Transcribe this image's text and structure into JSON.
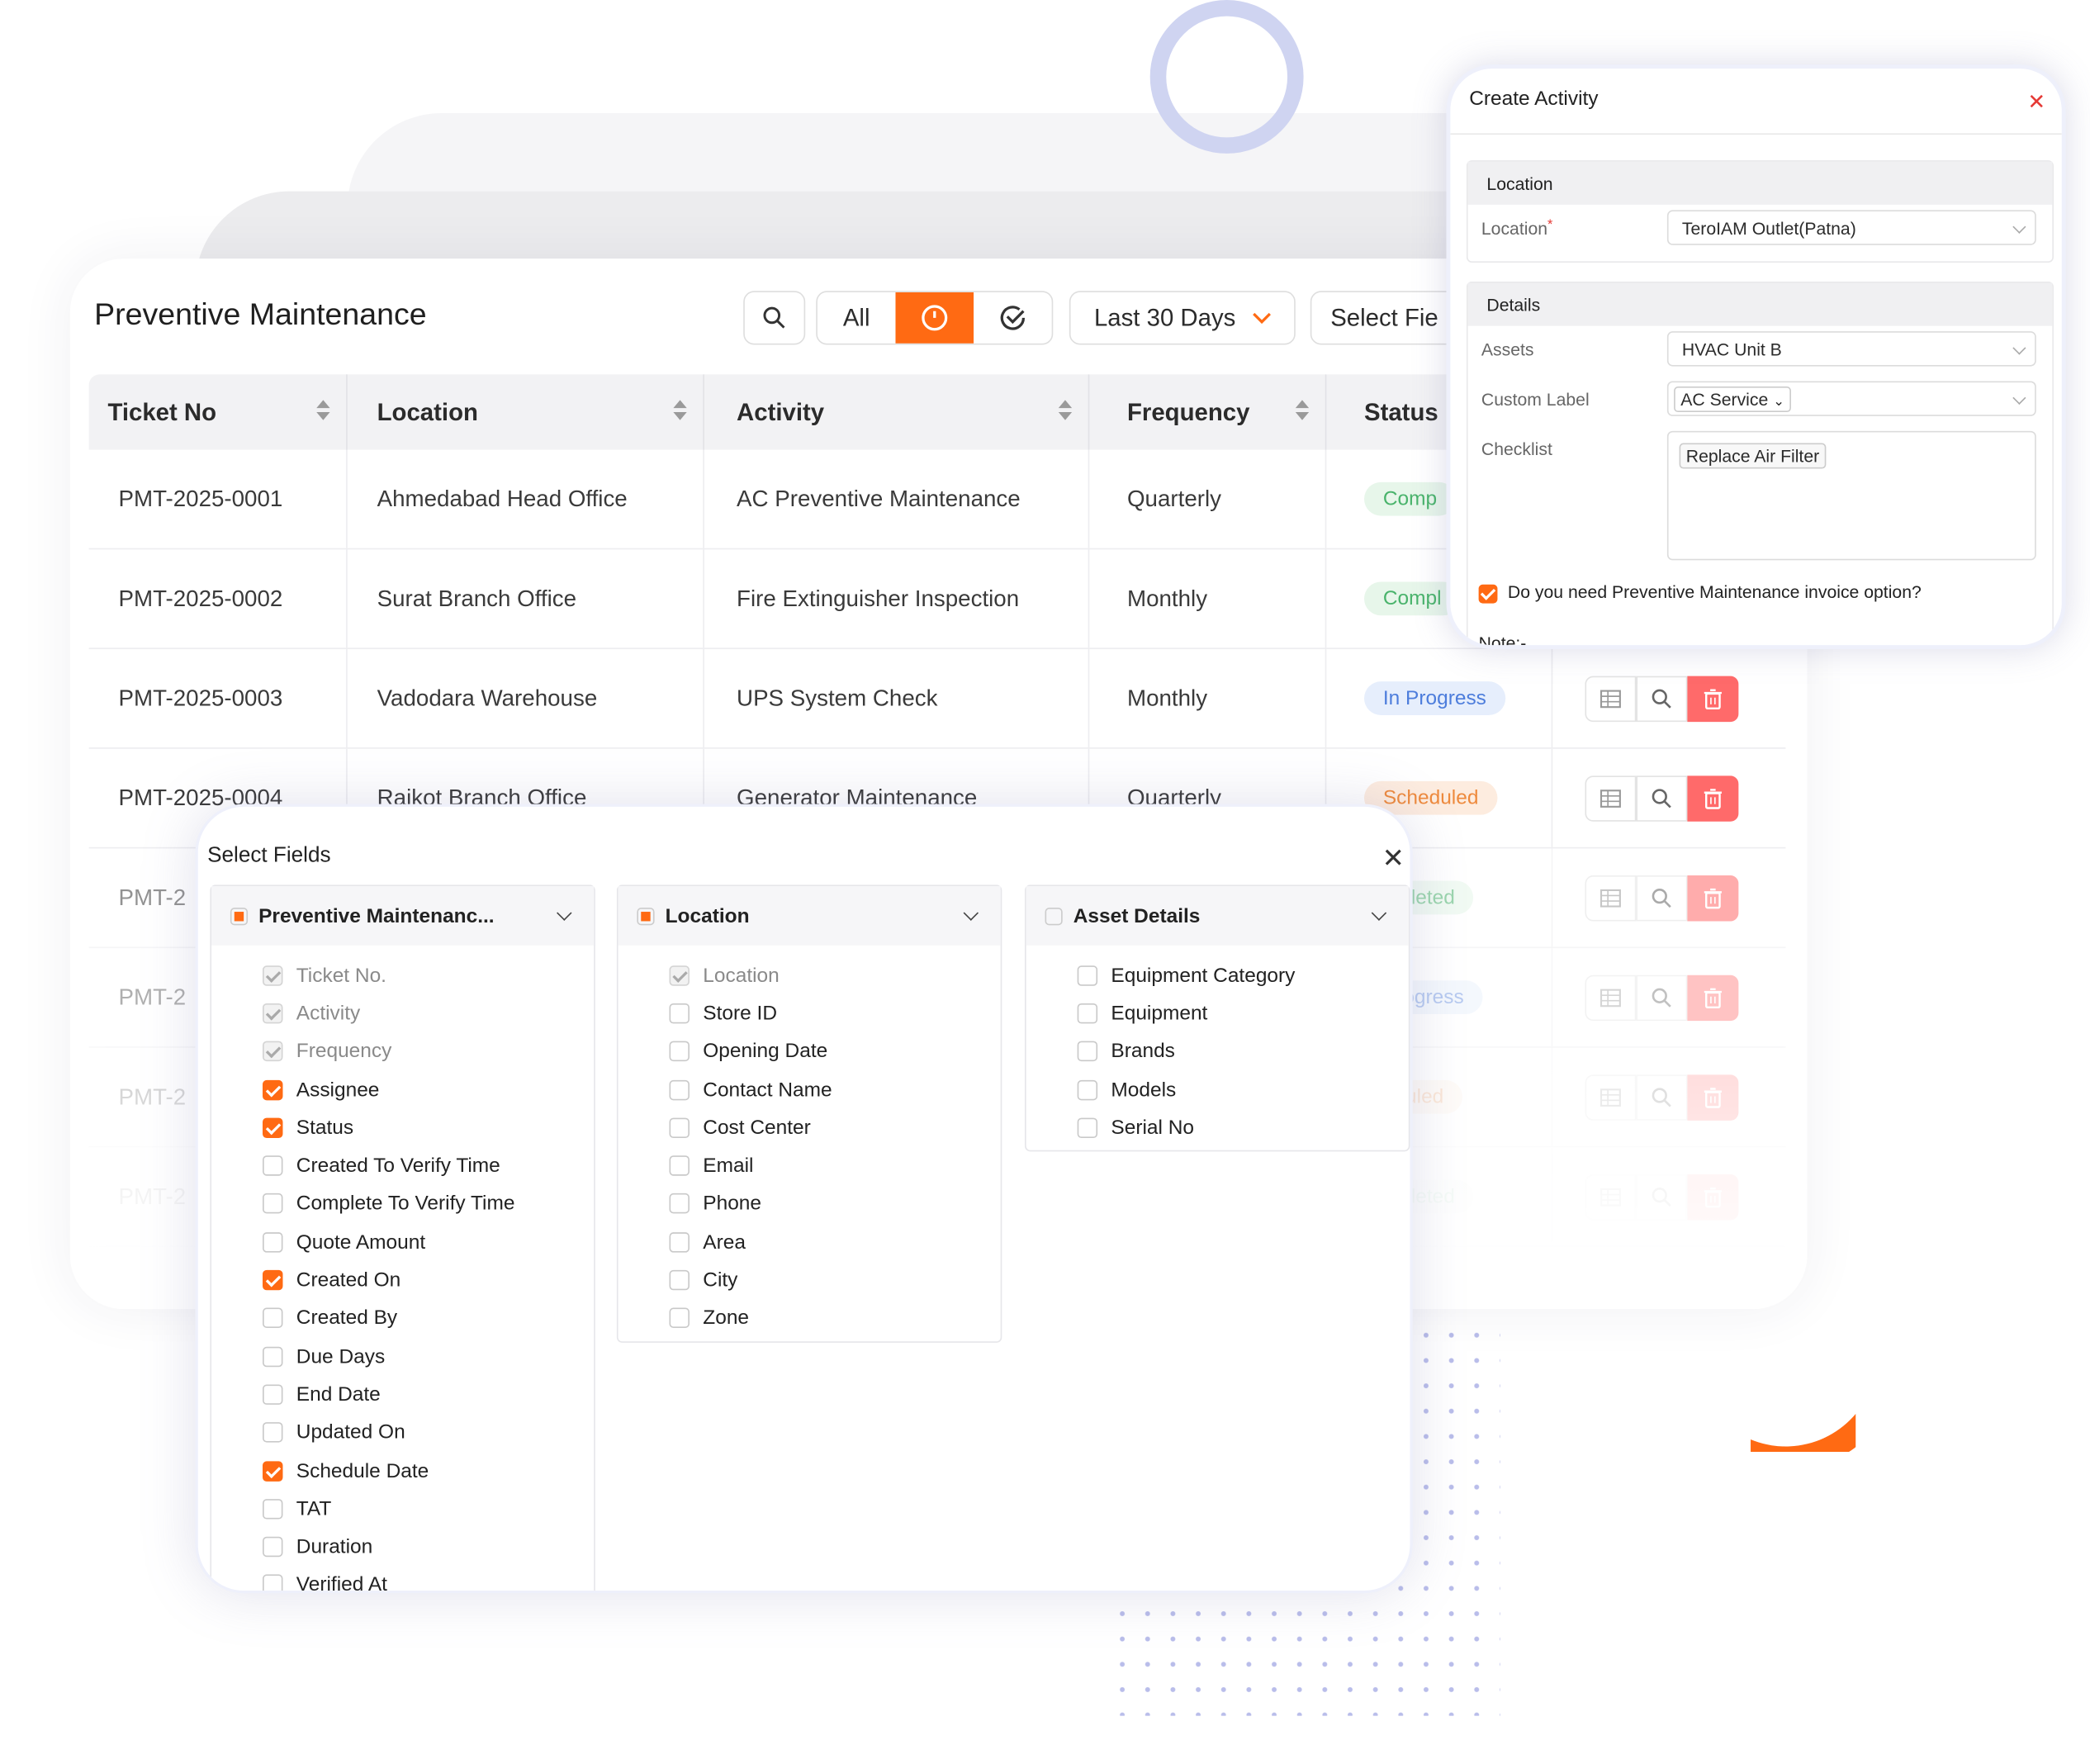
{
  "main": {
    "title": "Preventive Maintenance",
    "filters": {
      "all_label": "All",
      "range_label": "Last 30 Days",
      "select_fields_label": "Select Fie"
    },
    "columns": [
      "Ticket No",
      "Location",
      "Activity",
      "Frequency",
      "Status"
    ],
    "rows": [
      {
        "ticket": "PMT-2025-0001",
        "location": "Ahmedabad Head Office",
        "activity": "AC Preventive Maintenance",
        "frequency": "Quarterly",
        "status": "Comp"
      },
      {
        "ticket": "PMT-2025-0002",
        "location": "Surat Branch Office",
        "activity": "Fire Extinguisher Inspection",
        "frequency": "Monthly",
        "status": "Compl"
      },
      {
        "ticket": "PMT-2025-0003",
        "location": "Vadodara Warehouse",
        "activity": "UPS System Check",
        "frequency": "Monthly",
        "status": "In Progress"
      },
      {
        "ticket": "PMT-2025-0004",
        "location": "Rajkot Branch Office",
        "activity": "Generator Maintenance",
        "frequency": "Quarterly",
        "status": "Scheduled"
      },
      {
        "ticket": "PMT-2",
        "status": "mpleted"
      },
      {
        "ticket": "PMT-2",
        "status": "Progress"
      },
      {
        "ticket": "PMT-2",
        "status": "eduled"
      },
      {
        "ticket": "PMT-2",
        "status": "mpleted"
      }
    ]
  },
  "create_activity": {
    "title": "Create Activity",
    "location_section": "Location",
    "location_label": "Location",
    "location_value": "TeroIAM Outlet(Patna)",
    "details_section": "Details",
    "assets_label": "Assets",
    "assets_value": "HVAC Unit B",
    "custom_label_label": "Custom Label",
    "custom_label_value": "AC Service",
    "checklist_label": "Checklist",
    "checklist_value": "Replace Air Filter",
    "invoice_question": "Do you need  Preventive Maintenance invoice option?",
    "note_label": "Note:-"
  },
  "select_fields": {
    "title": "Select Fields",
    "groups": [
      {
        "name": "Preventive Maintenanc...",
        "items": [
          "Ticket No.",
          "Activity",
          "Frequency",
          "Assignee",
          "Status",
          "Created To Verify Time",
          "Complete To Verify Time",
          "Quote Amount",
          "Created On",
          "Created By",
          "Due Days",
          "End Date",
          "Updated On",
          "Schedule Date",
          "TAT",
          "Duration",
          "Verified At"
        ]
      },
      {
        "name": "Location",
        "items": [
          "Location",
          "Store ID",
          "Opening Date",
          "Contact Name",
          "Cost Center",
          "Email",
          "Phone",
          "Area",
          "City",
          "Zone"
        ]
      },
      {
        "name": "Asset Details",
        "items": [
          "Equipment Category",
          "Equipment",
          "Brands",
          "Models",
          "Serial No"
        ]
      }
    ]
  },
  "colors": {
    "accent": "#ff6a13",
    "ring": "#cfd4f1",
    "dots": "#b9bdea"
  }
}
